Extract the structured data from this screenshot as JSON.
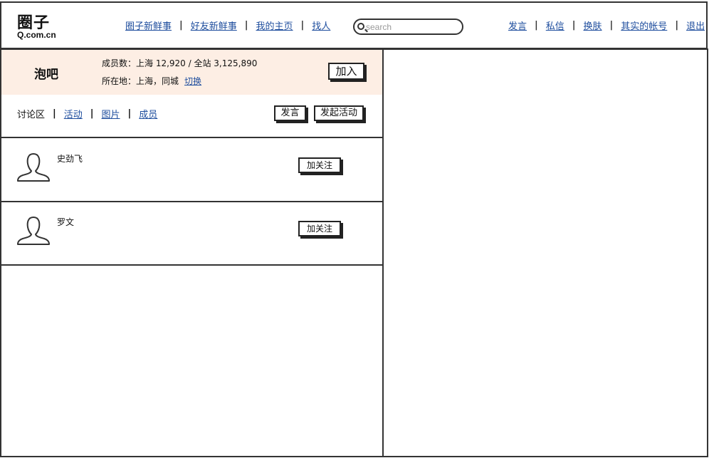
{
  "brand": {
    "title": "圈子",
    "subtitle": "Q.com.cn"
  },
  "nav_left": [
    "圈子新鲜事",
    "好友新鲜事",
    "我的主页",
    "找人"
  ],
  "search": {
    "placeholder": "search"
  },
  "nav_right": [
    "发言",
    "私信",
    "换肤",
    "其实的帐号",
    "退出"
  ],
  "group": {
    "name": "泡吧",
    "members_line": "成员数：上海 12,920 / 全站 3,125,890",
    "location_line": "所在地：上海，同城",
    "switch_label": "切换",
    "join_label": "加入"
  },
  "tabs": {
    "current": "讨论区",
    "links": [
      "活动",
      "图片",
      "成员"
    ]
  },
  "actions": {
    "post_label": "发言",
    "event_label": "发起活动"
  },
  "members": [
    {
      "name": "史劲飞",
      "follow_label": "加关注"
    },
    {
      "name": "罗文",
      "follow_label": "加关注"
    }
  ]
}
